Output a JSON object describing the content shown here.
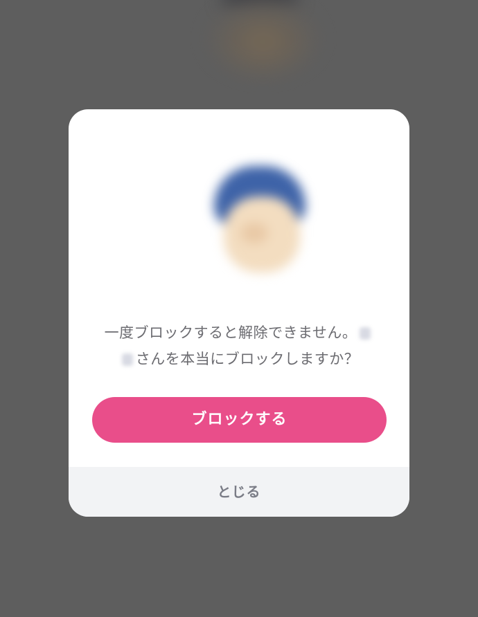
{
  "dialog": {
    "message_line1": "一度ブロックすると解除できません。",
    "message_line2": "さんを本当にブロックしますか？",
    "block_button_label": "ブロックする",
    "close_label": "とじる"
  },
  "colors": {
    "overlay": "#5e5e5e",
    "primary": "#e94e8a",
    "footer_bg": "#f2f3f5",
    "text": "#6b6b70"
  }
}
